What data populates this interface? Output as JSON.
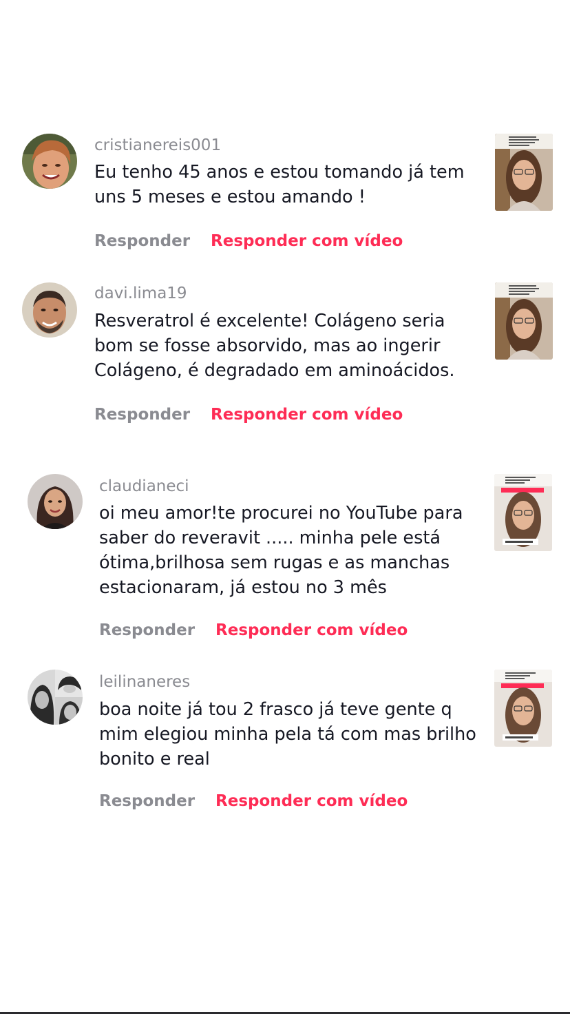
{
  "comments": [
    {
      "username": "cristianereis001",
      "lines": [
        "Eu tenho 45 anos e estou tomando já tem",
        "uns 5 meses e estou amando !"
      ],
      "reply_label": "Responder",
      "reply_video_label": "Responder com vídeo"
    },
    {
      "username": "davi.lima19",
      "lines": [
        "Resveratrol é excelente! Colágeno seria",
        "bom se fosse absorvido, mas ao ingerir",
        "Colágeno, é degradado em aminoácidos."
      ],
      "reply_label": "Responder",
      "reply_video_label": "Responder com vídeo"
    },
    {
      "username": "claudianeci",
      "lines": [
        "oi meu amor!te procurei no YouTube para",
        "saber do reveravit ..... minha pele está",
        "ótima,brilhosa sem rugas e as manchas",
        "estacionaram, já estou no 3 mês"
      ],
      "reply_label": "Responder",
      "reply_video_label": "Responder com vídeo"
    },
    {
      "username": "leilinaneres",
      "lines": [
        "boa noite já tou 2 frasco já teve gente q",
        "mim elegiou minha pela tá com mas brilho",
        "bonito e real"
      ],
      "reply_label": "Responder",
      "reply_video_label": "Responder com vídeo"
    }
  ],
  "colors": {
    "accent": "#fe2c55",
    "secondary_text": "#8a8b91",
    "primary_text": "#161823"
  }
}
